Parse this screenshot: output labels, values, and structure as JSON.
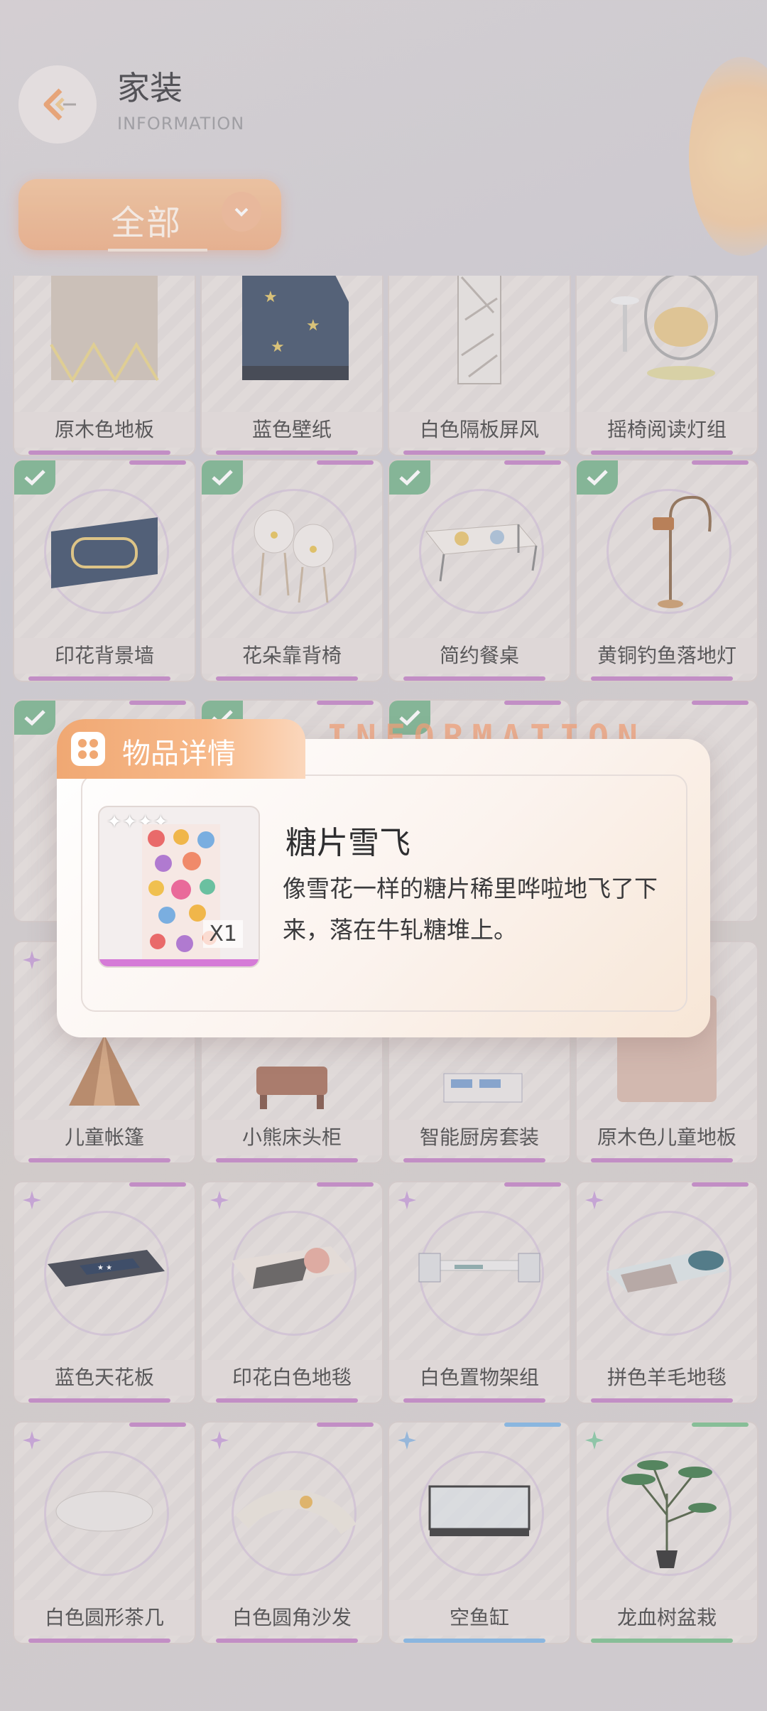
{
  "header": {
    "title": "家装",
    "subtitle": "INFORMATION"
  },
  "filter": {
    "label": "全部"
  },
  "items": [
    "原木色地板",
    "蓝色壁纸",
    "白色隔板屏风",
    "摇椅阅读灯组",
    "印花背景墙",
    "花朵靠背椅",
    "简约餐桌",
    "黄铜钓鱼落地灯",
    "儿童帐篷",
    "小熊床头柜",
    "智能厨房套装",
    "原木色儿童地板",
    "蓝色天花板",
    "印花白色地毯",
    "白色置物架组",
    "拼色羊毛地毯",
    "白色圆形茶几",
    "白色圆角沙发",
    "空鱼缸",
    "龙血树盆栽"
  ],
  "modal": {
    "tab_label": "物品详情",
    "watermark": "INFORMATION",
    "item": {
      "name": "糖片雪飞",
      "quantity": "X1",
      "description": "像雪花一样的糖片稀里哗啦地飞了下来，落在牛轧糖堆上。",
      "stars": 4
    }
  },
  "colors": {
    "accent": "#f0a873",
    "check": "#79b58e",
    "purple_stripe": "#c486c6",
    "blue_stripe": "#7fb6e6",
    "green_stripe": "#7cc08e"
  }
}
